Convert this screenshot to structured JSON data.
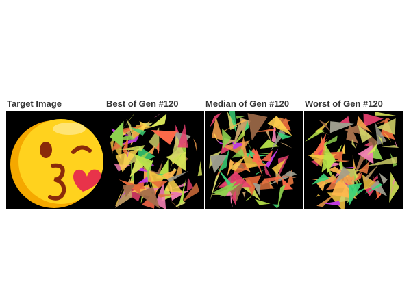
{
  "panels": [
    {
      "id": "target",
      "title": "Target Image"
    },
    {
      "id": "best",
      "title": "Best of Gen #120"
    },
    {
      "id": "median",
      "title": "Median of Gen #120"
    },
    {
      "id": "worst",
      "title": "Worst of Gen #120"
    }
  ],
  "colors": {
    "background": "#000000",
    "emoji_yellow": "#FFD21E",
    "emoji_shade": "#F5A800",
    "feature_brown": "#8A2A0A",
    "heart_red": "#E8334A"
  },
  "palette": [
    "#F4C542",
    "#FFD34E",
    "#F29E4C",
    "#E86A3A",
    "#B9E34A",
    "#8FD14F",
    "#D8E65A",
    "#C9A36B",
    "#9E9E8F",
    "#E83F6F",
    "#F27FB2",
    "#C03AE0",
    "#3DD67A",
    "#E0743E",
    "#FFB84D",
    "#A46E4B",
    "#D4D46A",
    "#FF6B4A"
  ]
}
